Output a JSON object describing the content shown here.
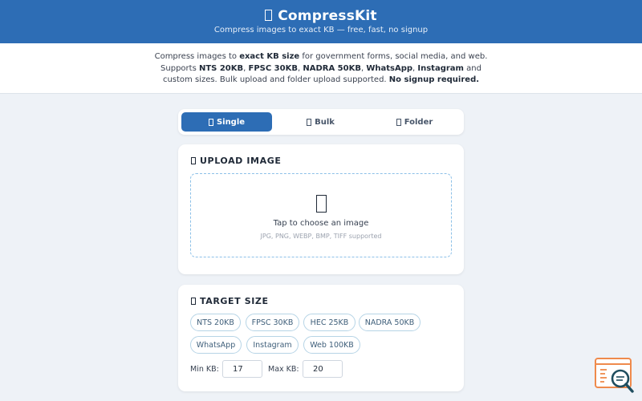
{
  "header": {
    "title": "CompressKit",
    "subtitle": "Compress images to exact KB — free, fast, no signup"
  },
  "intro": {
    "t1": "Compress images to ",
    "b1": "exact KB size",
    "t2": " for government forms, social media, and web.",
    "t3": "Supports ",
    "b2": "NTS 20KB",
    "t4": ", ",
    "b3": "FPSC 30KB",
    "t5": ", ",
    "b4": "NADRA 50KB",
    "t6": ", ",
    "b5": "WhatsApp",
    "t7": ", ",
    "b6": "Instagram",
    "t8": " and",
    "t9": "custom sizes. Bulk upload and folder upload supported. ",
    "b7": "No signup required."
  },
  "tabs": [
    {
      "label": "Single",
      "icon": "image-icon",
      "active": true
    },
    {
      "label": "Bulk",
      "icon": "images-icon",
      "active": false
    },
    {
      "label": "Folder",
      "icon": "folder-icon",
      "active": false
    }
  ],
  "upload": {
    "title": "UPLOAD IMAGE",
    "prompt": "Tap to choose an image",
    "hint": "JPG, PNG, WEBP, BMP, TIFF supported"
  },
  "target": {
    "title": "TARGET SIZE",
    "presets": [
      "NTS 20KB",
      "FPSC 30KB",
      "HEC 25KB",
      "NADRA 50KB",
      "WhatsApp",
      "Instagram",
      "Web 100KB"
    ],
    "min_label": "Min KB:",
    "min_value": "17",
    "max_label": "Max KB:",
    "max_value": "20"
  },
  "colors": {
    "header_bg": "#2d6db5",
    "accent": "#2d6db5",
    "page_bg": "#eef2f7",
    "dropzone_border": "#8cc0e8",
    "widget_orange": "#ef8a4c",
    "widget_teal": "#1f4e5f"
  }
}
